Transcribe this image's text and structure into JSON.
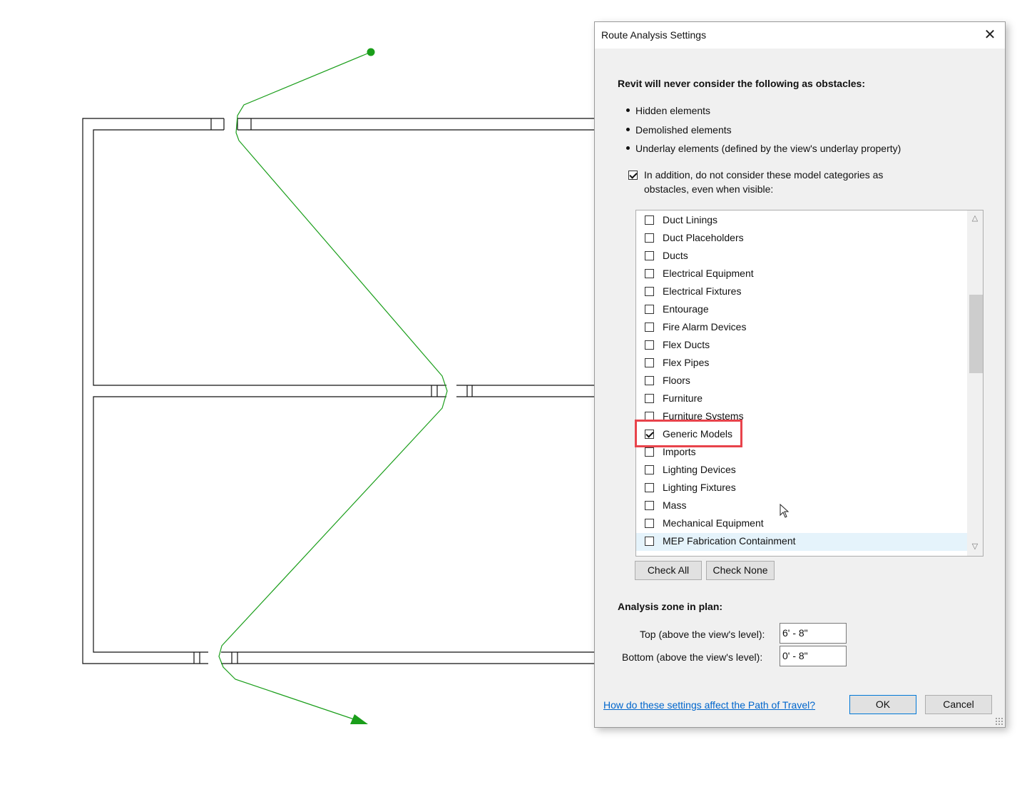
{
  "dialog": {
    "title": "Route Analysis Settings",
    "close_glyph": "✕",
    "heading": "Revit will never consider the following as obstacles:",
    "bullets": [
      "Hidden elements",
      "Demolished elements",
      "Underlay elements (defined by the view's underlay property)"
    ],
    "addition_checkbox": {
      "checked": true,
      "line1": "In addition, do not consider these model categories as",
      "line2": "obstacles, even when visible:"
    },
    "categories": [
      {
        "label": "Duct Linings",
        "checked": false
      },
      {
        "label": "Duct Placeholders",
        "checked": false
      },
      {
        "label": "Ducts",
        "checked": false
      },
      {
        "label": "Electrical Equipment",
        "checked": false
      },
      {
        "label": "Electrical Fixtures",
        "checked": false
      },
      {
        "label": "Entourage",
        "checked": false
      },
      {
        "label": "Fire Alarm Devices",
        "checked": false
      },
      {
        "label": "Flex Ducts",
        "checked": false
      },
      {
        "label": "Flex Pipes",
        "checked": false
      },
      {
        "label": "Floors",
        "checked": false
      },
      {
        "label": "Furniture",
        "checked": false
      },
      {
        "label": "Furniture Systems",
        "checked": false
      },
      {
        "label": "Generic Models",
        "checked": true
      },
      {
        "label": "Imports",
        "checked": false
      },
      {
        "label": "Lighting Devices",
        "checked": false
      },
      {
        "label": "Lighting Fixtures",
        "checked": false
      },
      {
        "label": "Mass",
        "checked": false
      },
      {
        "label": "Mechanical Equipment",
        "checked": false
      },
      {
        "label": "MEP Fabrication Containment",
        "checked": false
      }
    ],
    "check_all_label": "Check All",
    "check_none_label": "Check None",
    "zone_heading": "Analysis zone in plan:",
    "top_label": "Top (above the view's level):",
    "top_value": "6' - 8\"",
    "bottom_label": "Bottom (above the view's level):",
    "bottom_value": "0' - 8\"",
    "help_link": "How do these settings affect the Path of Travel?",
    "ok_label": "OK",
    "cancel_label": "Cancel"
  },
  "colors": {
    "path": "#1a9e1a",
    "highlight": "#e8434b",
    "link": "#0066cc"
  }
}
